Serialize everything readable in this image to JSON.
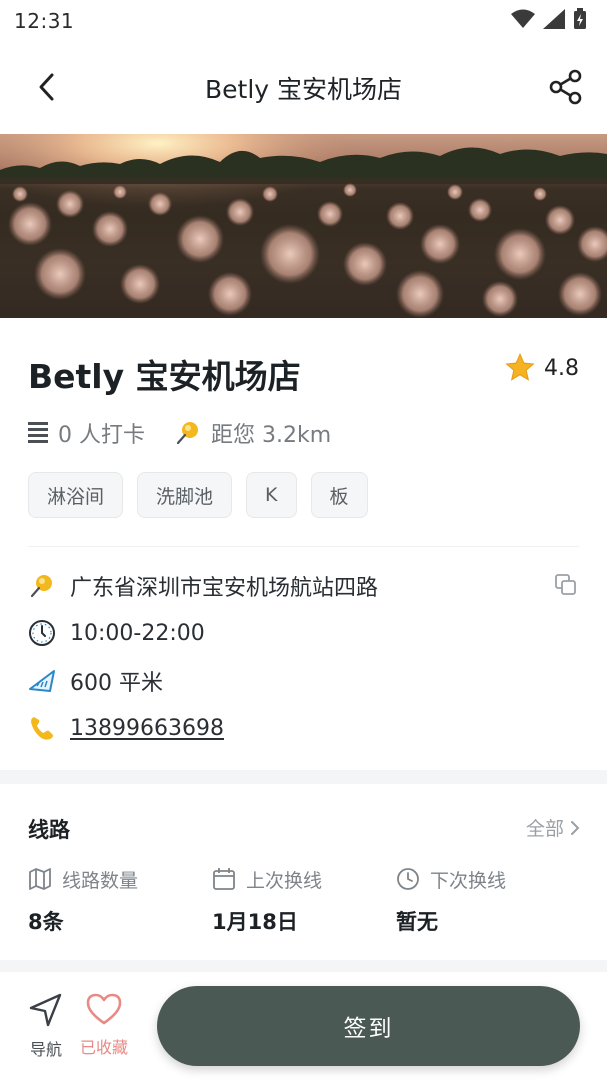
{
  "status_bar": {
    "time": "12:31"
  },
  "nav": {
    "title": "Betly 宝安机场店"
  },
  "store": {
    "name": "Betly 宝安机场店",
    "rating": "4.8",
    "checkins": "0 人打卡",
    "distance": "距您 3.2km",
    "tags": [
      "淋浴间",
      "洗脚池",
      "K",
      "板"
    ]
  },
  "info": {
    "address": "广东省深圳市宝安机场航站四路",
    "hours": "10:00-22:00",
    "area": "600 平米",
    "phone": "13899663698"
  },
  "route": {
    "title": "线路",
    "all_label": "全部",
    "stats": [
      {
        "label": "线路数量",
        "value": "8条",
        "icon": "map-icon"
      },
      {
        "label": "上次换线",
        "value": "1月18日",
        "icon": "calendar-icon"
      },
      {
        "label": "下次换线",
        "value": "暂无",
        "icon": "clock-icon"
      }
    ]
  },
  "bottom": {
    "nav_label": "导航",
    "fav_label": "已收藏",
    "checkin_label": "签到"
  },
  "colors": {
    "accent_button": "#4b5954",
    "favorite": "#e88a86",
    "star": "#f5b324",
    "pin": "#f2b81d"
  }
}
